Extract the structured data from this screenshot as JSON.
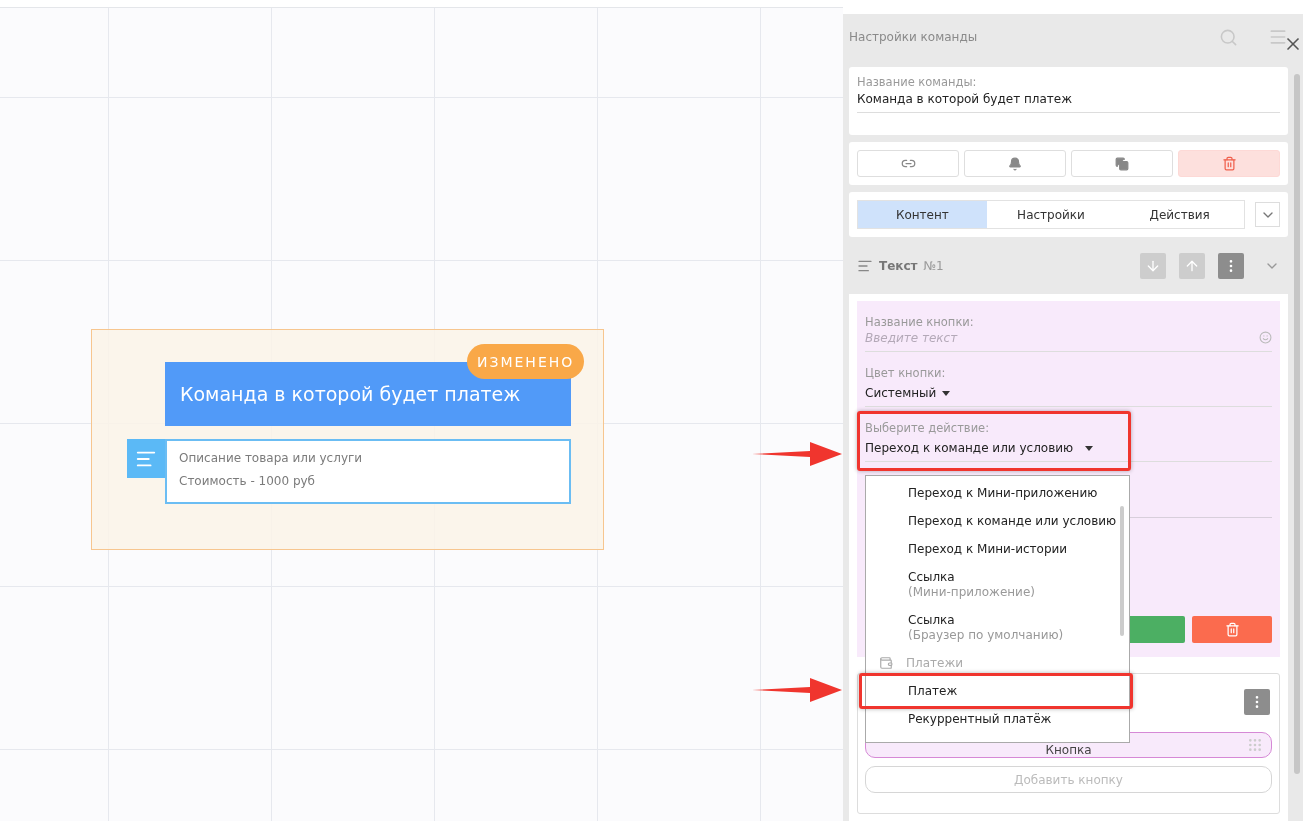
{
  "node": {
    "title": "Команда в которой будет платеж",
    "badge": "ИЗМЕНЕНО",
    "lines": [
      "Описание товара или услуги",
      "Стоимость - 1000 руб"
    ]
  },
  "panel": {
    "title": "Настройки команды",
    "name_field": {
      "label": "Название команды:",
      "value": "Команда в которой будет платеж"
    },
    "tabs": [
      {
        "label": "Контент",
        "selected": true
      },
      {
        "label": "Настройки",
        "selected": false
      },
      {
        "label": "Действия",
        "selected": false
      }
    ],
    "section": {
      "title": "Текст",
      "number": "№1"
    },
    "button_name": {
      "label": "Название кнопки:",
      "placeholder": "Введите текст"
    },
    "button_color": {
      "label": "Цвет кнопки:",
      "value": "Системный"
    },
    "action": {
      "label": "Выберите действие:",
      "value": "Переход к команде или условию"
    },
    "dropdown": [
      {
        "kind": "option",
        "label": "Переход к Мини-приложению"
      },
      {
        "kind": "option",
        "label": "Переход к команде или условию"
      },
      {
        "kind": "option",
        "label": "Переход к Мини-истории"
      },
      {
        "kind": "option",
        "label": "Ссылка",
        "sublabel": "(Мини-приложение)"
      },
      {
        "kind": "option",
        "label": "Ссылка",
        "sublabel": "(Браузер по умолчанию)"
      },
      {
        "kind": "group",
        "label": "Платежи"
      },
      {
        "kind": "option",
        "label": "Платеж"
      },
      {
        "kind": "option",
        "label": "Рекуррентный платёж"
      }
    ],
    "keyboard": {
      "button": "Кнопка",
      "add_button": "Добавить кнопку"
    }
  }
}
